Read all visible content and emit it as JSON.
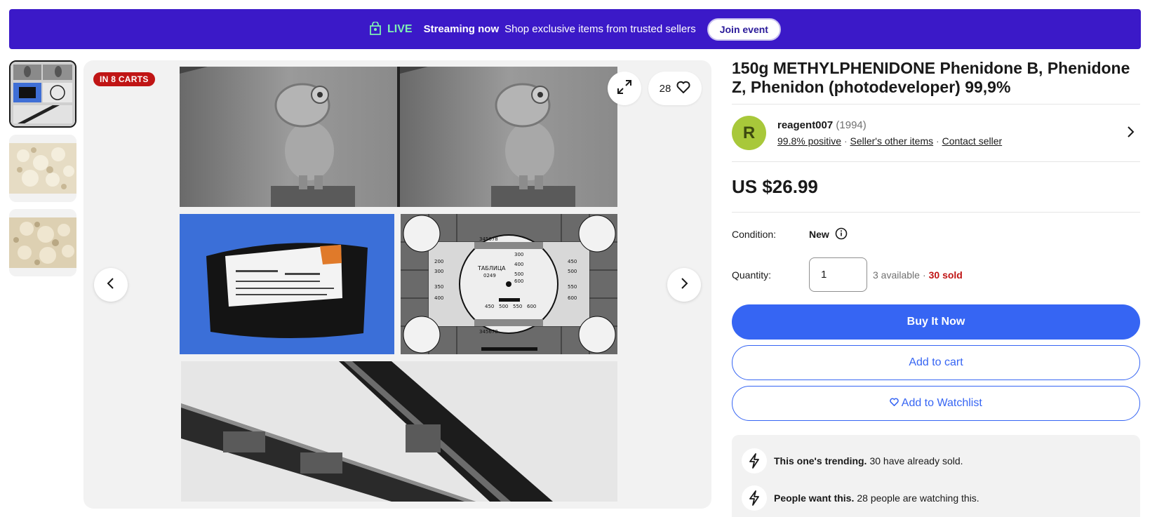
{
  "banner": {
    "icon": "shopping-bag-icon",
    "live_label": "LIVE",
    "streaming_label": "Streaming now",
    "message": "Shop exclusive items from trusted sellers",
    "join_label": "Join event",
    "colors": {
      "background": "#3b19c8",
      "live": "#7ef0b4"
    }
  },
  "gallery": {
    "badge": "IN 8 CARTS",
    "watch_count": "28",
    "thumbnails": [
      "collage-thumbnail",
      "powder-thumbnail",
      "powder-thumbnail"
    ],
    "chart_text": {
      "title_ru": "ТАБЛИЦА",
      "code": "0249",
      "nums": [
        "300",
        "400",
        "500",
        "600",
        "200",
        "300",
        "350",
        "400",
        "450",
        "500",
        "550",
        "600",
        "450",
        "500",
        "550",
        "600"
      ],
      "scale": "345678"
    },
    "package_text": {
      "code": "523013",
      "weight": "0,1кг"
    }
  },
  "product": {
    "title": "150g METHYLPHENIDONE Phenidone B, Phenidone Z, Phenidon (photodeveloper) 99,9%",
    "price": "US $26.99"
  },
  "seller": {
    "avatar_letter": "R",
    "name": "reagent007",
    "score": "(1994)",
    "positive": "99.8% positive",
    "other_items": "Seller's other items",
    "contact": "Contact seller",
    "separator": "·"
  },
  "condition": {
    "label": "Condition:",
    "value": "New"
  },
  "quantity": {
    "label": "Quantity:",
    "value": "1",
    "available": "3 available",
    "separator": "·",
    "sold": "30 sold"
  },
  "buttons": {
    "buy": "Buy It Now",
    "cart": "Add to cart",
    "watchlist": "Add to Watchlist"
  },
  "trending": [
    {
      "icon": "lightning-icon",
      "bold": "This one's trending.",
      "text": "30 have already sold."
    },
    {
      "icon": "lightning-icon",
      "bold": "People want this.",
      "text": "28 people are watching this."
    }
  ],
  "colors": {
    "accent": "#3665f3",
    "alert": "#c01515",
    "avatar": "#a8c83a"
  }
}
